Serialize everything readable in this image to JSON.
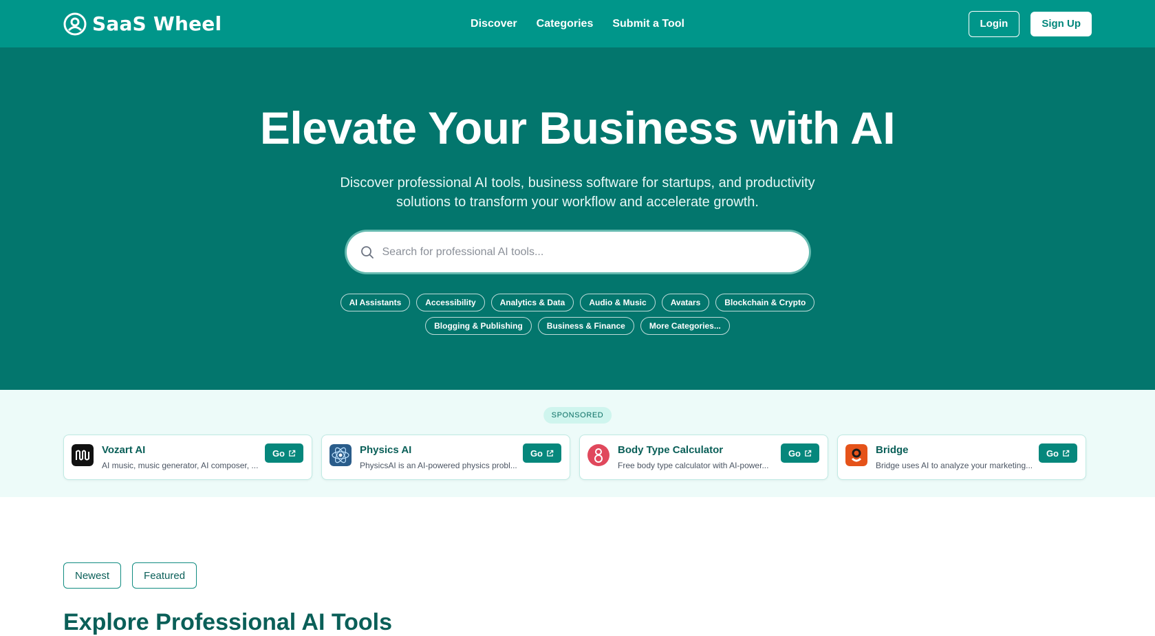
{
  "nav": {
    "brand": "SaaS Wheel",
    "links": [
      "Discover",
      "Categories",
      "Submit a Tool"
    ],
    "login": "Login",
    "signup": "Sign Up"
  },
  "hero": {
    "title": "Elevate Your Business with AI",
    "subtitle": "Discover professional AI tools, business software for startups, and productivity solutions to transform your workflow and accelerate growth.",
    "search_placeholder": "Search for professional AI tools...",
    "categories": [
      "AI Assistants",
      "Accessibility",
      "Analytics & Data",
      "Audio & Music",
      "Avatars",
      "Blockchain & Crypto",
      "Blogging & Publishing",
      "Business & Finance",
      "More Categories..."
    ]
  },
  "sponsored": {
    "badge": "SPONSORED",
    "go_label": "Go",
    "items": [
      {
        "name": "Vozart AI",
        "desc": "AI music, music generator, AI composer, ...",
        "icon": "vozart-logo-icon",
        "color": "#111111"
      },
      {
        "name": "Physics AI",
        "desc": "PhysicsAI is an AI-powered physics probl...",
        "icon": "physics-ai-logo-icon",
        "color": "#2a5c8a"
      },
      {
        "name": "Body Type Calculator",
        "desc": "Free body type calculator with AI-power...",
        "icon": "body-type-logo-icon",
        "color": "#e0485c"
      },
      {
        "name": "Bridge",
        "desc": "Bridge uses AI to analyze your marketing...",
        "icon": "bridge-logo-icon",
        "color": "#e5531a"
      }
    ]
  },
  "filters": [
    "Newest",
    "Featured"
  ],
  "section_title": "Explore Professional AI Tools",
  "colors": {
    "nav_bg": "#00968a",
    "hero_bg": "#03766d",
    "accent": "#06877c",
    "sponsored_bg": "#edfbf9"
  }
}
